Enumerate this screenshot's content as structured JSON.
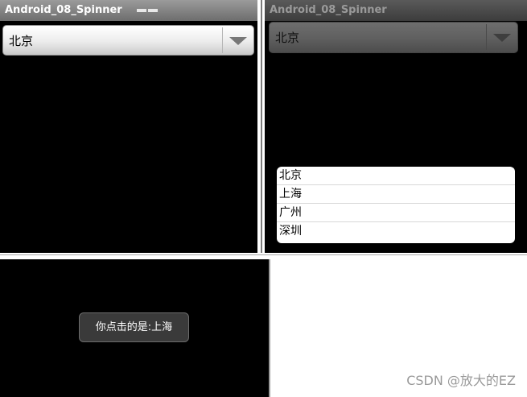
{
  "app": {
    "title": "Android_08_Spinner"
  },
  "spinner": {
    "selected": "北京"
  },
  "dropdown": {
    "options": [
      "北京",
      "上海",
      "广州",
      "深圳"
    ]
  },
  "toast": {
    "message": "你点击的是:上海"
  },
  "watermark": {
    "text": "CSDN @放大的EZ"
  }
}
